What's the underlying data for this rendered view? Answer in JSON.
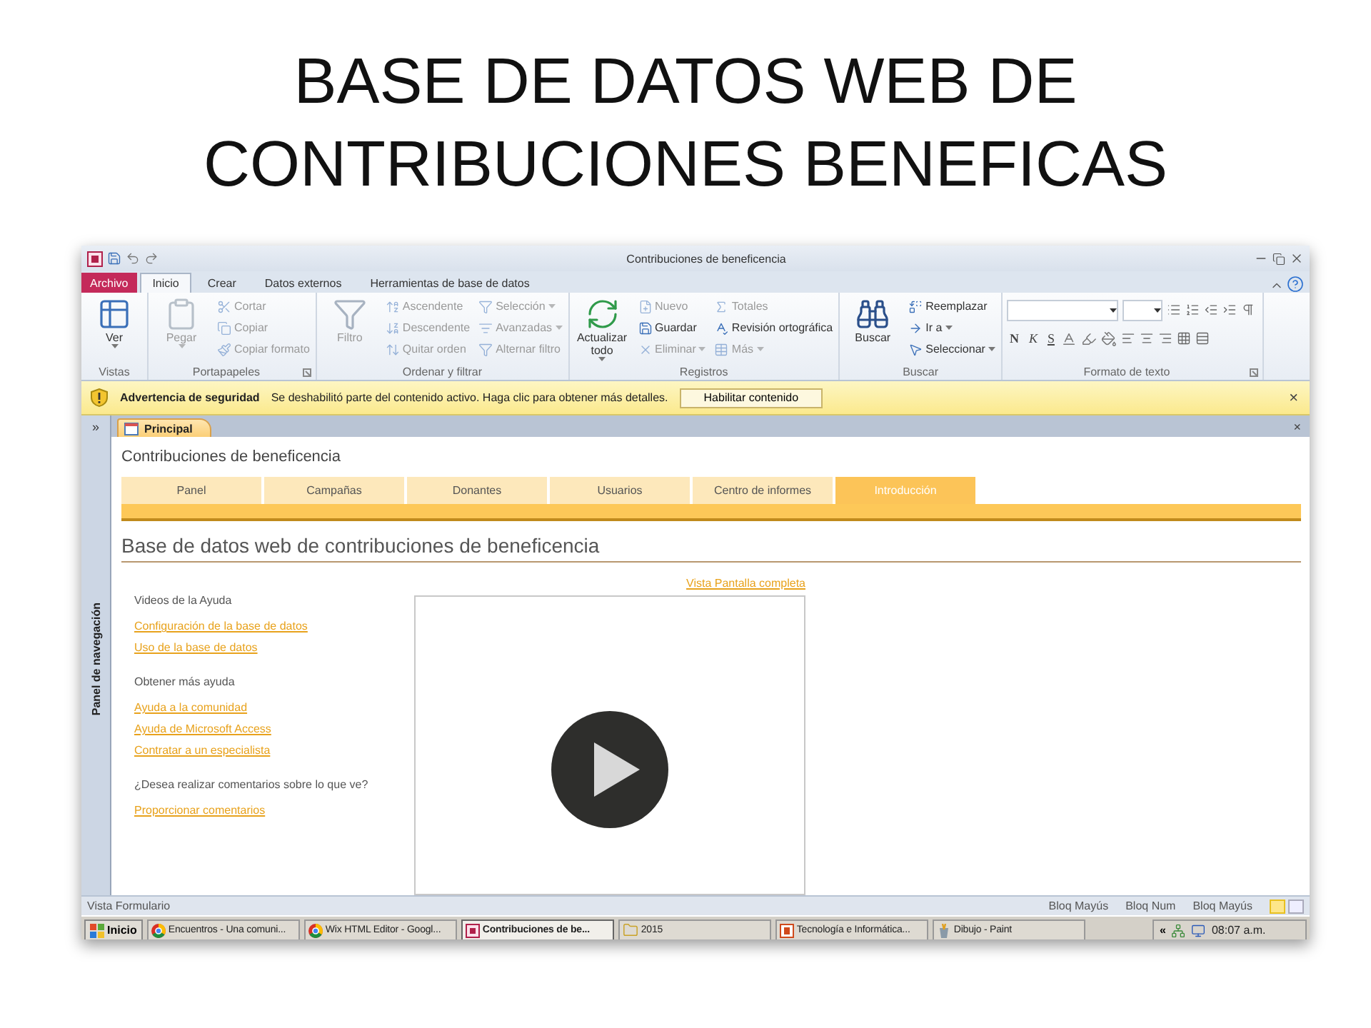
{
  "slide": {
    "title_lines": [
      "BASE DE DATOS WEB DE",
      "CONTRIBUCIONES BENEFICAS"
    ]
  },
  "window": {
    "title": "Contribuciones de beneficencia"
  },
  "ribbon": {
    "file_tab": "Archivo",
    "tabs": [
      {
        "label": "Inicio",
        "selected": true
      },
      {
        "label": "Crear",
        "selected": false
      },
      {
        "label": "Datos externos",
        "selected": false
      },
      {
        "label": "Herramientas de base de datos",
        "selected": false
      }
    ],
    "groups": [
      {
        "kind": "commands",
        "label": "Vistas",
        "launcher": false,
        "large": {
          "label": "Ver",
          "disabled": false,
          "dropdown": true
        }
      },
      {
        "kind": "commands",
        "label": "Portapapeles",
        "launcher": true,
        "large": {
          "label": "Pegar",
          "disabled": true,
          "dropdown": true
        },
        "columns": [
          [
            {
              "label": "Cortar",
              "disabled": true,
              "dropdown": false
            },
            {
              "label": "Copiar",
              "disabled": true,
              "dropdown": false
            },
            {
              "label": "Copiar formato",
              "disabled": true,
              "dropdown": false
            }
          ]
        ]
      },
      {
        "kind": "commands",
        "label": "Ordenar y filtrar",
        "launcher": false,
        "large": {
          "label": "Filtro",
          "disabled": true,
          "dropdown": false
        },
        "columns": [
          [
            {
              "label": "Ascendente",
              "disabled": true,
              "dropdown": false
            },
            {
              "label": "Descendente",
              "disabled": true,
              "dropdown": false
            },
            {
              "label": "Quitar orden",
              "disabled": true,
              "dropdown": false
            }
          ],
          [
            {
              "label": "Selección",
              "disabled": true,
              "dropdown": true
            },
            {
              "label": "Avanzadas",
              "disabled": true,
              "dropdown": true
            },
            {
              "label": "Alternar filtro",
              "disabled": true,
              "dropdown": false
            }
          ]
        ]
      },
      {
        "kind": "commands",
        "label": "Registros",
        "launcher": false,
        "large": {
          "label": "Actualizar todo",
          "disabled": false,
          "dropdown": true
        },
        "columns": [
          [
            {
              "label": "Nuevo",
              "disabled": true,
              "dropdown": false
            },
            {
              "label": "Guardar",
              "disabled": false,
              "dropdown": false
            },
            {
              "label": "Eliminar",
              "disabled": true,
              "dropdown": true
            }
          ],
          [
            {
              "label": "Totales",
              "disabled": true,
              "dropdown": false
            },
            {
              "label": "Revisión ortográfica",
              "disabled": false,
              "dropdown": false
            },
            {
              "label": "Más",
              "disabled": true,
              "dropdown": true
            }
          ]
        ]
      },
      {
        "kind": "commands",
        "label": "Buscar",
        "launcher": false,
        "large": {
          "label": "Buscar",
          "disabled": false,
          "dropdown": false
        },
        "columns": [
          [
            {
              "label": "Reemplazar",
              "disabled": false,
              "dropdown": false
            },
            {
              "label": "Ir a",
              "disabled": false,
              "dropdown": true
            },
            {
              "label": "Seleccionar",
              "disabled": false,
              "dropdown": true
            }
          ]
        ]
      },
      {
        "kind": "text_format",
        "label": "Formato de texto",
        "launcher": true,
        "format_buttons": [
          "N",
          "K",
          "S"
        ]
      }
    ]
  },
  "security_bar": {
    "title": "Advertencia de seguridad",
    "message": "Se deshabilitó parte del contenido activo. Haga clic para obtener más detalles.",
    "button": "Habilitar contenido",
    "close": "×"
  },
  "navigation_pane": {
    "toggle": "»",
    "label": "Panel de navegación"
  },
  "document_tab": {
    "label": "Principal",
    "close": "×"
  },
  "form": {
    "title": "Contribuciones de beneficencia",
    "tabs": [
      {
        "label": "Panel",
        "selected": false
      },
      {
        "label": "Campañas",
        "selected": false
      },
      {
        "label": "Donantes",
        "selected": false
      },
      {
        "label": "Usuarios",
        "selected": false
      },
      {
        "label": "Centro de informes",
        "selected": false
      },
      {
        "label": "Introducción",
        "selected": true
      }
    ],
    "heading": "Base de datos web de contribuciones de beneficencia",
    "sections": [
      {
        "heading": "Videos de la Ayuda",
        "links": [
          "Configuración de la base de datos",
          "Uso de la base de datos"
        ]
      },
      {
        "heading": "Obtener más ayuda",
        "links": [
          "Ayuda a la comunidad",
          "Ayuda de Microsoft Access",
          "Contratar a un especialista"
        ]
      },
      {
        "heading": "¿Desea realizar comentarios sobre lo que ve?",
        "links": [
          "Proporcionar comentarios"
        ]
      }
    ],
    "fullscreen_link": "Vista Pantalla completa"
  },
  "status_bar": {
    "view": "Vista Formulario",
    "indicators": [
      "Bloq Mayús",
      "Bloq Num",
      "Bloq Mayús"
    ],
    "views": [
      {
        "selected": true
      },
      {
        "selected": false
      }
    ]
  },
  "taskbar": {
    "start": "Inicio",
    "items": [
      {
        "kind": "browser",
        "label": "Encuentros - Una comuni...",
        "selected": false
      },
      {
        "kind": "browser",
        "label": "Wix HTML Editor - Googl...",
        "selected": false
      },
      {
        "kind": "database",
        "label": "Contribuciones de be...",
        "selected": true
      },
      {
        "kind": "folder",
        "label": "2015",
        "selected": false
      },
      {
        "kind": "presentation",
        "label": "Tecnología e Informática...",
        "selected": false
      },
      {
        "kind": "paint",
        "label": "Dibujo - Paint",
        "selected": false
      }
    ],
    "tray_toggle": "«",
    "time": "08:07 a.m."
  }
}
